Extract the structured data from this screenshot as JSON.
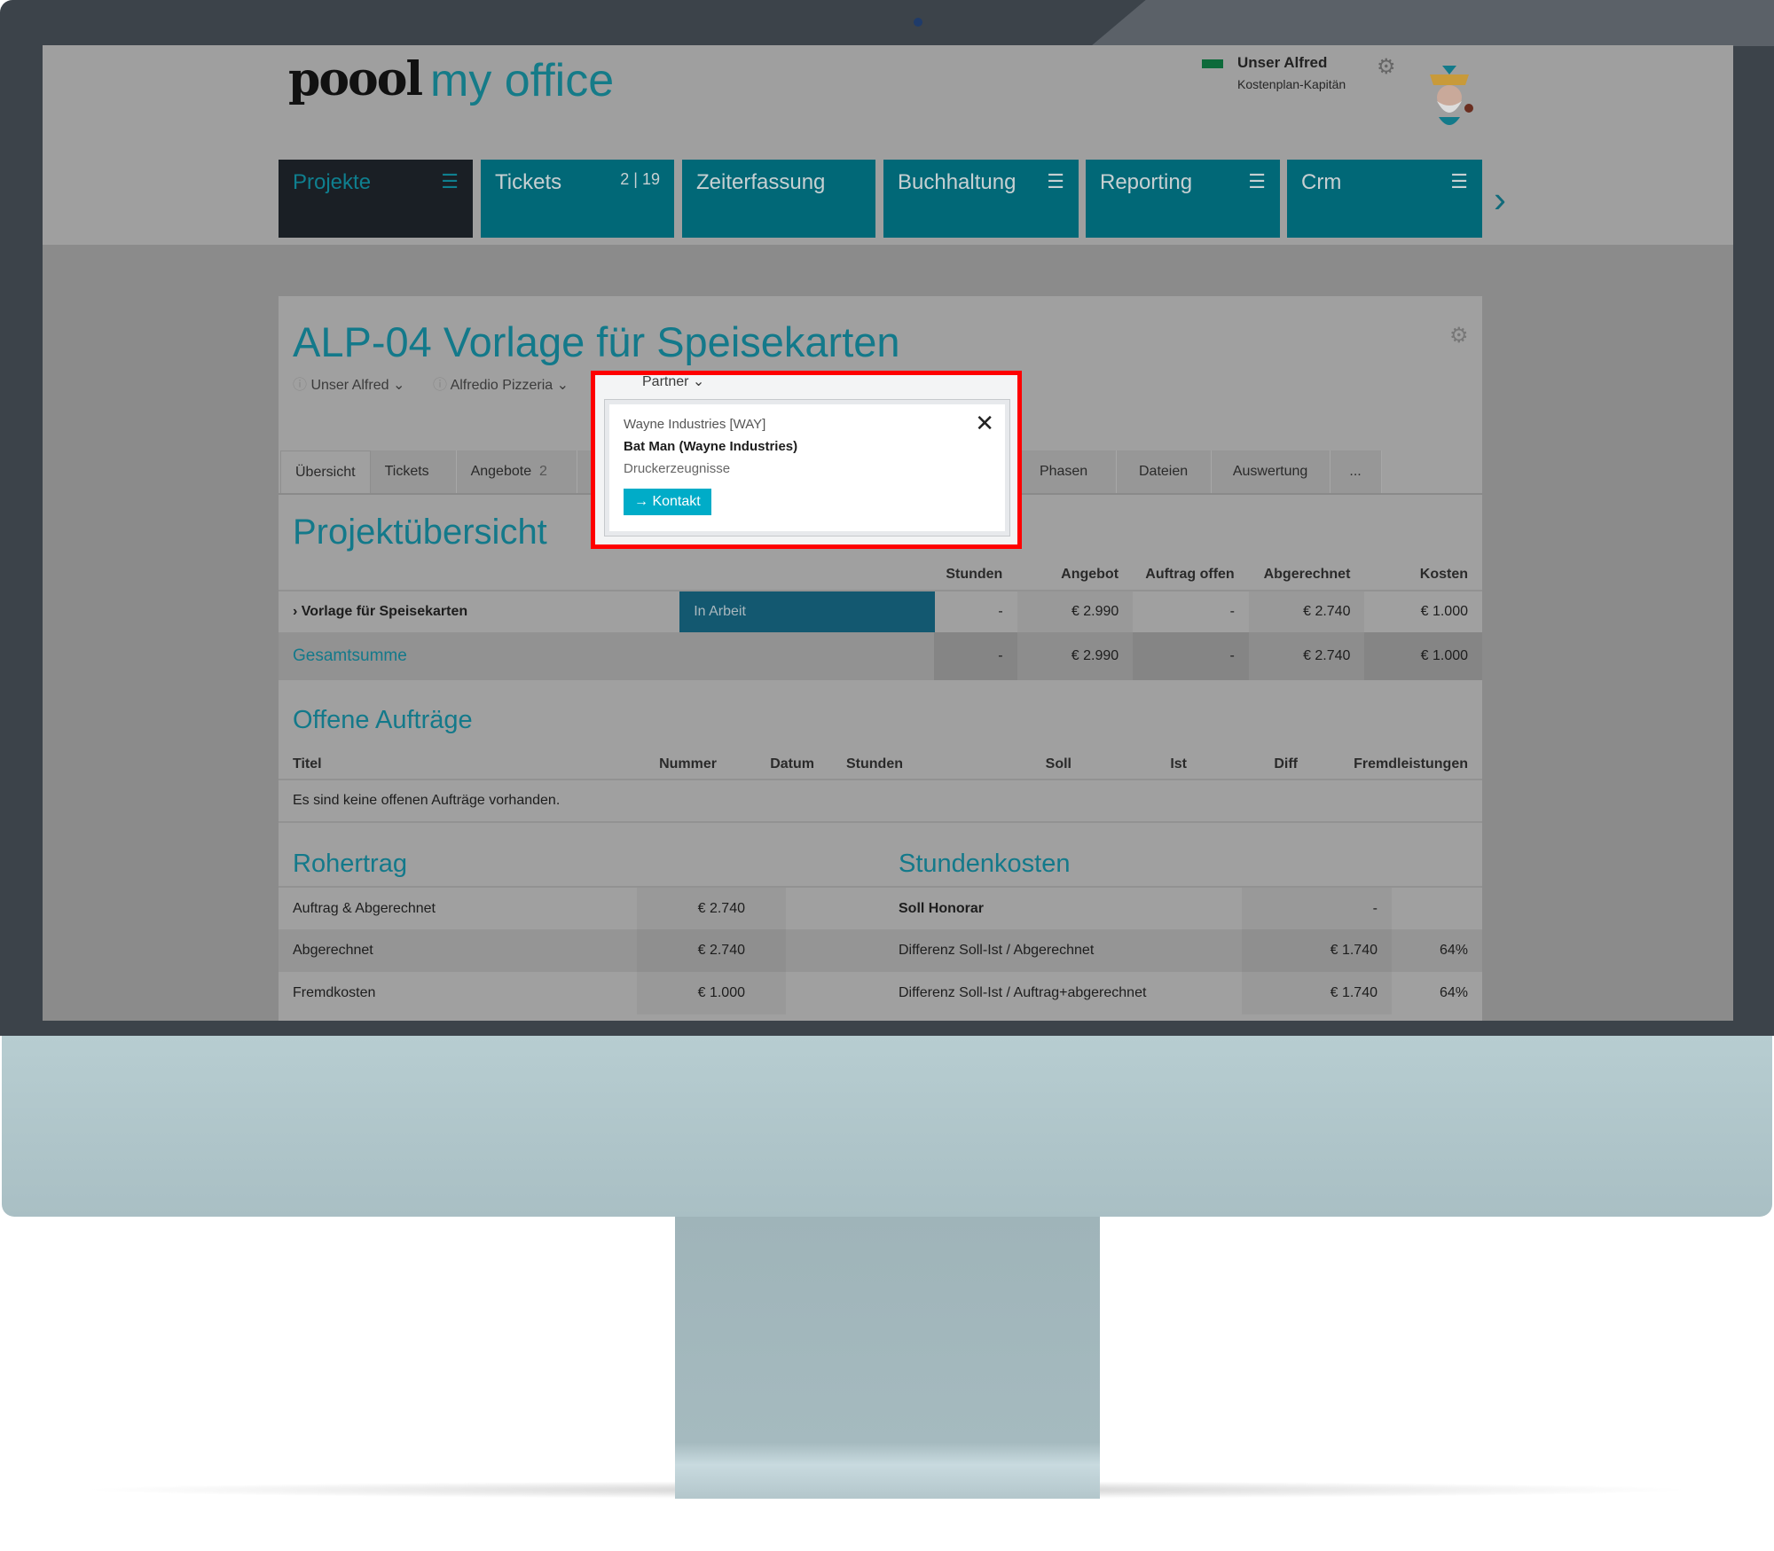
{
  "header": {
    "logo_brand": "poool",
    "logo_product": "my office",
    "user_name": "Unser Alfred",
    "user_role": "Kostenplan-Kapitän"
  },
  "nav": [
    {
      "label": "Projekte",
      "active": true,
      "menu": true
    },
    {
      "label": "Tickets",
      "badge": "2 | 19"
    },
    {
      "label": "Zeiterfassung"
    },
    {
      "label": "Buchhaltung",
      "menu": true
    },
    {
      "label": "Reporting",
      "menu": true
    },
    {
      "label": "Crm",
      "menu": true
    }
  ],
  "project": {
    "title": "ALP-04 Vorlage für Speisekarten",
    "owner": "Unser Alfred",
    "client": "Alfredio Pizzeria",
    "partner_label": "Partner"
  },
  "tabs": [
    {
      "label": "Übersicht",
      "active": true
    },
    {
      "label": "Tickets"
    },
    {
      "label": "Angebote",
      "count": "2"
    },
    {
      "label": "Phasen"
    },
    {
      "label": "Dateien"
    },
    {
      "label": "Auswertung"
    },
    {
      "label": "..."
    }
  ],
  "popup": {
    "company": "Wayne Industries [WAY]",
    "contact": "Bat Man (Wayne Industries)",
    "category": "Druckerzeugnisse",
    "button": "Kontakt"
  },
  "overview": {
    "heading": "Projektübersicht",
    "columns": [
      "Stunden",
      "Angebot",
      "Auftrag offen",
      "Abgerechnet",
      "Kosten"
    ],
    "row": {
      "label": "Vorlage für Speisekarten",
      "status": "In Arbeit",
      "values": [
        "-",
        "€ 2.990",
        "-",
        "€ 2.740",
        "€ 1.000"
      ]
    },
    "total": {
      "label": "Gesamtsumme",
      "values": [
        "-",
        "€ 2.990",
        "-",
        "€ 2.740",
        "€ 1.000"
      ]
    }
  },
  "orders": {
    "heading": "Offene Aufträge",
    "columns": [
      "Titel",
      "Nummer",
      "Datum",
      "Stunden",
      "Soll",
      "Ist",
      "Diff",
      "Fremdleistungen"
    ],
    "empty": "Es sind keine offenen Aufträge vorhanden."
  },
  "rohertrag": {
    "heading": "Rohertrag",
    "rows": [
      {
        "label": "Auftrag & Abgerechnet",
        "value": "€ 2.740"
      },
      {
        "label": "Abgerechnet",
        "value": "€ 2.740"
      },
      {
        "label": "Fremdkosten",
        "value": "€ 1.000"
      }
    ]
  },
  "stundenkosten": {
    "heading": "Stundenkosten",
    "rows": [
      {
        "label": "Soll Honorar",
        "value": "-",
        "pct": ""
      },
      {
        "label": "Differenz Soll-Ist / Abgerechnet",
        "value": "€ 1.740",
        "pct": "64%"
      },
      {
        "label": "Differenz Soll-Ist / Auftrag+abgerechnet",
        "value": "€ 1.740",
        "pct": "64%"
      }
    ]
  },
  "colors": {
    "accent": "#13798a",
    "nav": "#016877",
    "status": "#135870",
    "highlight": "#ff0000",
    "button": "#00acc8"
  }
}
